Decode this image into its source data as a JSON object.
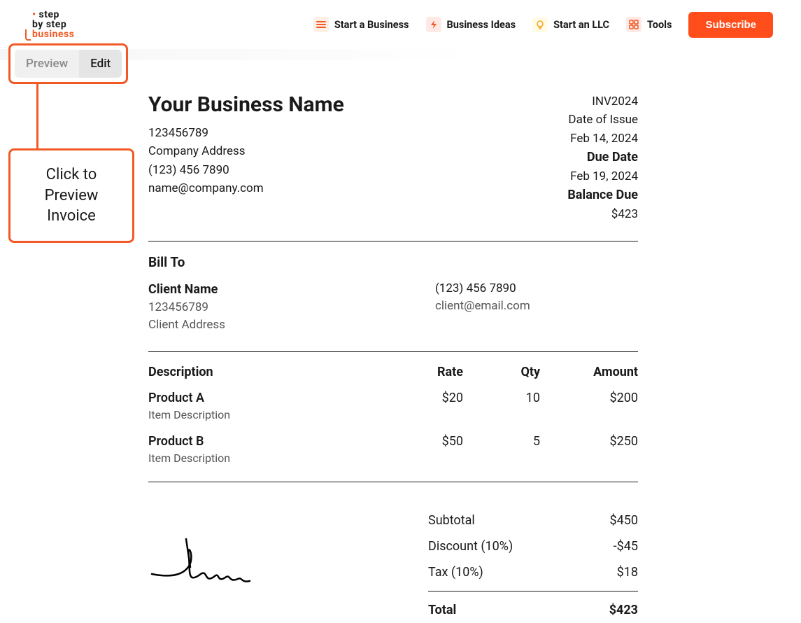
{
  "nav": {
    "logo_line1": "step",
    "logo_line2": "by step",
    "logo_line3": "business",
    "items": [
      {
        "label": "Start a Business"
      },
      {
        "label": "Business Ideas"
      },
      {
        "label": "Start an LLC"
      },
      {
        "label": "Tools"
      }
    ],
    "subscribe": "Subscribe"
  },
  "toggle": {
    "preview": "Preview",
    "edit": "Edit"
  },
  "tip": "Click to Preview Invoice",
  "invoice": {
    "business": {
      "name": "Your Business Name",
      "id": "123456789",
      "address": "Company Address",
      "phone": "(123) 456 7890",
      "email": "name@company.com"
    },
    "meta": {
      "number": "INV2024",
      "issue_label": "Date of Issue",
      "issue_date": "Feb 14, 2024",
      "due_label": "Due Date",
      "due_date": "Feb 19, 2024",
      "balance_label": "Balance Due",
      "balance": "$423"
    },
    "bill_to_label": "Bill To",
    "client": {
      "name": "Client Name",
      "id": "123456789",
      "address": "Client Address",
      "phone": "(123) 456 7890",
      "email": "client@email.com"
    },
    "columns": {
      "desc": "Description",
      "rate": "Rate",
      "qty": "Qty",
      "amount": "Amount"
    },
    "items": [
      {
        "name": "Product A",
        "desc": "Item Description",
        "rate": "$20",
        "qty": "10",
        "amount": "$200"
      },
      {
        "name": "Product B",
        "desc": "Item Description",
        "rate": "$50",
        "qty": "5",
        "amount": "$250"
      }
    ],
    "totals": {
      "subtotal_label": "Subtotal",
      "subtotal": "$450",
      "discount_label": "Discount (10%)",
      "discount": "-$45",
      "tax_label": "Tax (10%)",
      "tax": "$18",
      "total_label": "Total",
      "total": "$423"
    }
  }
}
